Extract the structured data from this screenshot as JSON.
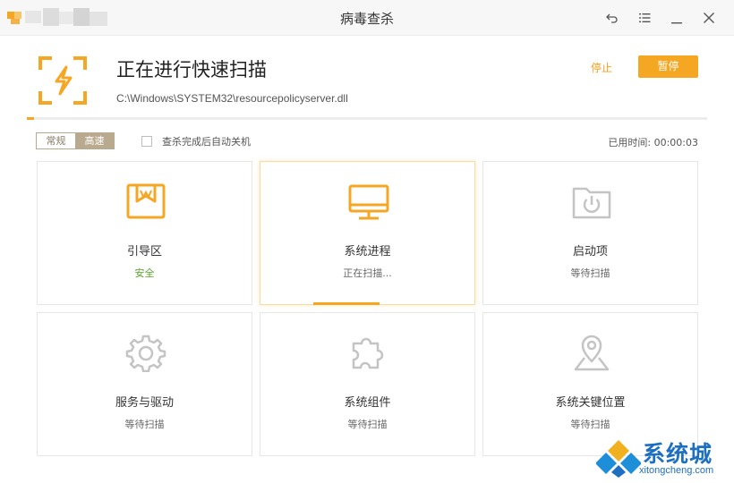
{
  "window": {
    "title": "病毒查杀",
    "controls": [
      "undo-icon",
      "menu-icon",
      "minimize-icon",
      "close-icon"
    ]
  },
  "header": {
    "title": "正在进行快速扫描",
    "current_file": "C:\\Windows\\SYSTEM32\\resourcepolicyserver.dll",
    "stop_label": "停止",
    "pause_label": "暂停",
    "icon": "lightning-scan-icon"
  },
  "progress": {
    "fraction": 0.01
  },
  "options": {
    "modes": [
      "常规",
      "高速"
    ],
    "selected_mode": "高速",
    "auto_shutdown_label": "查杀完成后自动关机",
    "auto_shutdown_checked": false,
    "elapsed_label": "已用时间:",
    "elapsed_time": "00:00:03"
  },
  "cards": [
    {
      "name": "引导区",
      "status": "安全",
      "state": "safe",
      "icon": "boot-sector-icon"
    },
    {
      "name": "系统进程",
      "status": "正在扫描...",
      "state": "scanning",
      "icon": "monitor-icon"
    },
    {
      "name": "启动项",
      "status": "等待扫描",
      "state": "waiting",
      "icon": "startup-folder-icon"
    },
    {
      "name": "服务与驱动",
      "status": "等待扫描",
      "state": "waiting",
      "icon": "gear-icon"
    },
    {
      "name": "系统组件",
      "status": "等待扫描",
      "state": "waiting",
      "icon": "puzzle-icon"
    },
    {
      "name": "系统关键位置",
      "status": "等待扫描",
      "state": "waiting",
      "icon": "location-pin-icon"
    }
  ],
  "colors": {
    "accent": "#f5a623",
    "safe": "#5aa02c",
    "inactive_icon": "#c4c4c4",
    "watermark_blue": "#1d6fc1"
  },
  "watermark": {
    "cn": "系统城",
    "en": "xitongcheng.com"
  }
}
